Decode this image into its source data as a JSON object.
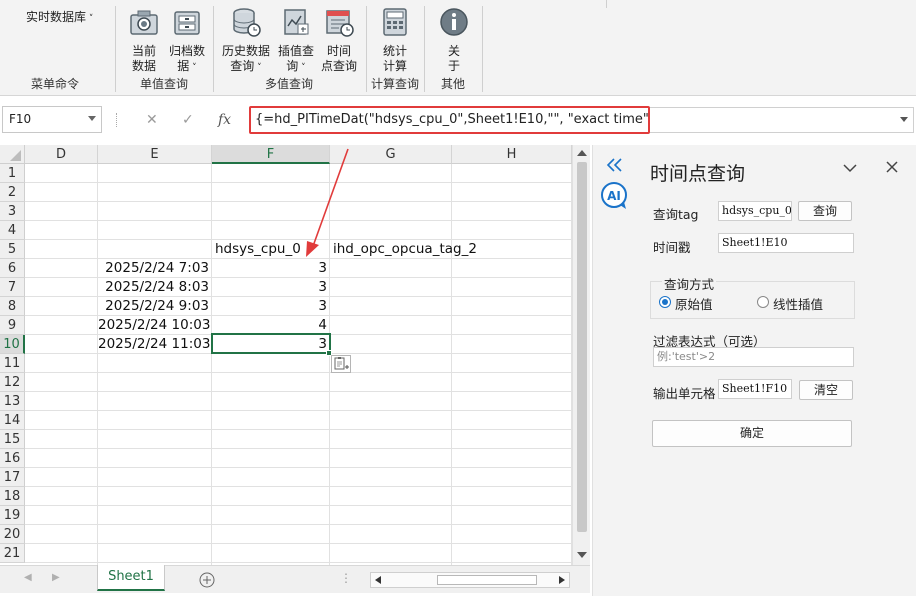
{
  "ribbon": {
    "menu_group": {
      "dropdown_label": "实时数据库",
      "group_label": "菜单命令"
    },
    "single_query": {
      "group_label": "单值查询",
      "current_line1": "当前",
      "current_line2": "数据",
      "archive_line1": "归档数",
      "archive_line2": "据"
    },
    "multi_query": {
      "group_label": "多值查询",
      "history_line1": "历史数据",
      "history_line2": "查询",
      "interp_line1": "插值查",
      "interp_line2": "询",
      "timepoint_line1": "时间",
      "timepoint_line2": "点查询"
    },
    "calc_query": {
      "group_label": "计算查询",
      "stats_line1": "统计",
      "stats_line2": "计算"
    },
    "other": {
      "group_label": "其他",
      "about_line1": "关",
      "about_line2": "于"
    }
  },
  "formula_bar": {
    "name_box": "F10",
    "fx_label": "fx",
    "formula": "{=hd_PITimeDat(\"hdsys_cpu_0\",Sheet1!E10,\"\", \"exact time\")}"
  },
  "sheet": {
    "columns": [
      "D",
      "E",
      "F",
      "G",
      "H"
    ],
    "rows": [
      "1",
      "2",
      "3",
      "4",
      "5",
      "6",
      "7",
      "8",
      "9",
      "10",
      "11",
      "12",
      "13",
      "14",
      "15",
      "16",
      "17",
      "18",
      "19",
      "20",
      "21"
    ],
    "headers": {
      "F5": "hdsys_cpu_0",
      "G5": "ihd_opc_opcua_tag_2"
    },
    "times": [
      "2025/2/24 7:03",
      "2025/2/24 8:03",
      "2025/2/24 9:03",
      "2025/2/24 10:03",
      "2025/2/24 11:03"
    ],
    "values": [
      "3",
      "3",
      "3",
      "4",
      "3"
    ],
    "selected_cell": "F10",
    "tab_name": "Sheet1"
  },
  "panel": {
    "title": "时间点查询",
    "tag_label": "查询tag",
    "tag_value": "hdsys_cpu_0",
    "query_button": "查询",
    "timestamp_label": "时间戳",
    "timestamp_value": "Sheet1!E10",
    "method_label": "查询方式",
    "method_option_raw": "原始值",
    "method_option_linear": "线性插值",
    "method_selected": "原始值",
    "filter_label": "过滤表达式（可选）",
    "filter_placeholder": "例:'test'>2",
    "output_label": "输出单元格",
    "output_value": "Sheet1!F10",
    "clear_button": "清空",
    "confirm_button": "确定"
  },
  "colors": {
    "accent_green": "#217346",
    "highlight_red": "#e13b3b",
    "ai_blue": "#1a73c9"
  }
}
